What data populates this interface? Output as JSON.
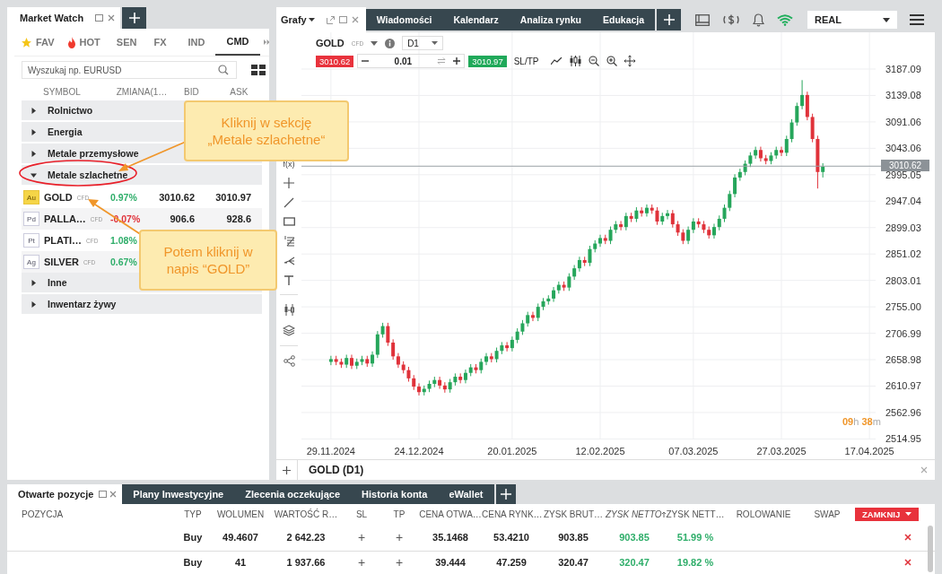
{
  "market_watch": {
    "title": "Market Watch",
    "categories": [
      {
        "label": "FAV",
        "selected": false
      },
      {
        "label": "HOT",
        "selected": false
      },
      {
        "label": "SEN",
        "selected": false
      },
      {
        "label": "FX",
        "selected": false
      },
      {
        "label": "IND",
        "selected": false
      },
      {
        "label": "CMD",
        "selected": true
      }
    ],
    "search": {
      "placeholder": "Wyszukaj np. EURUSD"
    },
    "columns": [
      "SYMBOL",
      "ZMIANA(1…",
      "BID",
      "ASK"
    ],
    "groups": [
      {
        "name": "Rolnictwo",
        "expanded": false
      },
      {
        "name": "Energia",
        "expanded": false
      },
      {
        "name": "Metale przemysłowe",
        "expanded": false
      },
      {
        "name": "Metale szlachetne",
        "expanded": true,
        "children": [
          {
            "badge": "Au",
            "symbol": "GOLD",
            "type": "CFD",
            "change": "0.97%",
            "color": "#2fae6a",
            "bid": "3010.62",
            "ask": "3010.97"
          },
          {
            "badge": "Pd",
            "symbol": "PALLA…",
            "type": "CFD",
            "change": "-0.07%",
            "color": "#e0323a",
            "bid": "906.6",
            "ask": "928.6"
          },
          {
            "badge": "Pt",
            "symbol": "PLATI…",
            "type": "CFD",
            "change": "1.08%",
            "color": "#2fae6a"
          },
          {
            "badge": "Ag",
            "symbol": "SILVER",
            "type": "CFD",
            "change": "0.67%",
            "color": "#2fae6a"
          }
        ]
      },
      {
        "name": "Inne",
        "expanded": false
      },
      {
        "name": "Inwentarz żywy",
        "expanded": false
      }
    ]
  },
  "chart_tabs": {
    "main": "Grafy",
    "tabs": [
      "Wiadomości",
      "Kalendarz",
      "Analiza rynku",
      "Edukacja"
    ]
  },
  "account": {
    "value": "REAL"
  },
  "chart": {
    "symbol": "GOLD",
    "type": "CFD",
    "timeframe": "D1",
    "sell": "3010.62",
    "volume": "0.01",
    "buy": "3010.97",
    "sltp": "SL/TP",
    "fx_label": "f(x)",
    "countdown": [
      {
        "value": "09",
        "unit": "h"
      },
      {
        "value": "38",
        "unit": "m"
      }
    ],
    "chart_data": {
      "type": "candlestick",
      "title": "GOLD (D1)",
      "grid": true,
      "ylim": [
        2514.95,
        3253.9
      ],
      "ref_lines": [
        {
          "axis": "y",
          "value": 3010.62,
          "label": "3010.62"
        }
      ],
      "yticks": [
        {
          "value": 3187.09,
          "label": "3187.09"
        },
        {
          "value": 3139.08,
          "label": "3139.08"
        },
        {
          "value": 3091.06,
          "label": "3091.06"
        },
        {
          "value": 3043.06,
          "label": "3043.06"
        },
        {
          "value": 2995.05,
          "label": "2995.05"
        },
        {
          "value": 2947.04,
          "label": "2947.04"
        },
        {
          "value": 2899.03,
          "label": "2899.03"
        },
        {
          "value": 2851.02,
          "label": "2851.02"
        },
        {
          "value": 2803.01,
          "label": "2803.01"
        },
        {
          "value": 2755.0,
          "label": "2755.00"
        },
        {
          "value": 2706.99,
          "label": "2706.99"
        },
        {
          "value": 2658.98,
          "label": "2658.98"
        },
        {
          "value": 2610.97,
          "label": "2610.97"
        },
        {
          "value": 2562.96,
          "label": "2562.96"
        },
        {
          "value": 2514.95,
          "label": "2514.95"
        }
      ],
      "categories": [
        "29.11.2024",
        null,
        null,
        null,
        null,
        null,
        null,
        null,
        null,
        null,
        null,
        null,
        null,
        null,
        null,
        null,
        null,
        "24.12.2024",
        null,
        null,
        null,
        null,
        null,
        null,
        null,
        null,
        null,
        null,
        null,
        null,
        null,
        null,
        null,
        null,
        null,
        "20.01.2025",
        null,
        null,
        null,
        null,
        null,
        null,
        null,
        null,
        null,
        null,
        null,
        null,
        null,
        null,
        null,
        null,
        "12.02.2025",
        null,
        null,
        null,
        null,
        null,
        null,
        null,
        null,
        null,
        null,
        null,
        null,
        null,
        null,
        null,
        null,
        null,
        "07.03.2025",
        null,
        null,
        null,
        null,
        null,
        null,
        null,
        null,
        null,
        null,
        null,
        null,
        null,
        null,
        null,
        null,
        "27.03.2025",
        null,
        null,
        null,
        null,
        null,
        null,
        null,
        null,
        null,
        null,
        null,
        null,
        null,
        null,
        null,
        null,
        "17.04.2025"
      ],
      "ohlc": [
        [
          2655,
          2666,
          2649,
          2660
        ],
        [
          2660,
          2666,
          2649,
          2655
        ],
        [
          2655,
          2661,
          2644,
          2650
        ],
        [
          2650,
          2668,
          2644,
          2662
        ],
        [
          2662,
          2668,
          2642,
          2648
        ],
        [
          2648,
          2661,
          2642,
          2655
        ],
        [
          2655,
          2666,
          2649,
          2660
        ],
        [
          2660,
          2666,
          2646,
          2652
        ],
        [
          2652,
          2674,
          2646,
          2668
        ],
        [
          2668,
          2711,
          2662,
          2705
        ],
        [
          2705,
          2726,
          2699,
          2720
        ],
        [
          2720,
          2726,
          2684,
          2690
        ],
        [
          2690,
          2696,
          2659,
          2665
        ],
        [
          2665,
          2671,
          2644,
          2650
        ],
        [
          2650,
          2656,
          2634,
          2640
        ],
        [
          2640,
          2646,
          2619,
          2625
        ],
        [
          2625,
          2631,
          2604,
          2610
        ],
        [
          2610,
          2616,
          2594,
          2600
        ],
        [
          2600,
          2612,
          2594,
          2606
        ],
        [
          2606,
          2621,
          2600,
          2615
        ],
        [
          2615,
          2628,
          2609,
          2622
        ],
        [
          2622,
          2628,
          2606,
          2612
        ],
        [
          2612,
          2618,
          2599,
          2605
        ],
        [
          2605,
          2624,
          2599,
          2618
        ],
        [
          2618,
          2634,
          2612,
          2628
        ],
        [
          2628,
          2634,
          2616,
          2622
        ],
        [
          2622,
          2641,
          2616,
          2635
        ],
        [
          2635,
          2651,
          2629,
          2645
        ],
        [
          2645,
          2651,
          2634,
          2640
        ],
        [
          2640,
          2661,
          2634,
          2655
        ],
        [
          2655,
          2671,
          2649,
          2665
        ],
        [
          2665,
          2671,
          2654,
          2660
        ],
        [
          2660,
          2681,
          2654,
          2675
        ],
        [
          2675,
          2691,
          2669,
          2685
        ],
        [
          2685,
          2691,
          2674,
          2680
        ],
        [
          2680,
          2701,
          2674,
          2695
        ],
        [
          2695,
          2716,
          2689,
          2710
        ],
        [
          2710,
          2731,
          2704,
          2725
        ],
        [
          2725,
          2746,
          2719,
          2740
        ],
        [
          2740,
          2746,
          2729,
          2735
        ],
        [
          2735,
          2761,
          2729,
          2755
        ],
        [
          2755,
          2771,
          2749,
          2765
        ],
        [
          2765,
          2776,
          2759,
          2770
        ],
        [
          2770,
          2791,
          2764,
          2785
        ],
        [
          2785,
          2801,
          2779,
          2795
        ],
        [
          2795,
          2801,
          2784,
          2790
        ],
        [
          2790,
          2816,
          2784,
          2810
        ],
        [
          2810,
          2831,
          2804,
          2825
        ],
        [
          2825,
          2846,
          2819,
          2840
        ],
        [
          2840,
          2846,
          2829,
          2835
        ],
        [
          2835,
          2866,
          2829,
          2860
        ],
        [
          2860,
          2876,
          2854,
          2870
        ],
        [
          2870,
          2886,
          2864,
          2880
        ],
        [
          2880,
          2886,
          2869,
          2875
        ],
        [
          2875,
          2901,
          2869,
          2895
        ],
        [
          2895,
          2911,
          2889,
          2905
        ],
        [
          2905,
          2911,
          2894,
          2900
        ],
        [
          2900,
          2926,
          2894,
          2920
        ],
        [
          2920,
          2926,
          2909,
          2915
        ],
        [
          2915,
          2936,
          2909,
          2930
        ],
        [
          2930,
          2936,
          2919,
          2925
        ],
        [
          2925,
          2941,
          2919,
          2935
        ],
        [
          2935,
          2941,
          2924,
          2930
        ],
        [
          2930,
          2936,
          2904,
          2910
        ],
        [
          2910,
          2926,
          2904,
          2920
        ],
        [
          2920,
          2931,
          2914,
          2925
        ],
        [
          2925,
          2931,
          2899,
          2905
        ],
        [
          2905,
          2911,
          2884,
          2890
        ],
        [
          2890,
          2896,
          2869,
          2875
        ],
        [
          2875,
          2901,
          2869,
          2895
        ],
        [
          2895,
          2916,
          2889,
          2910
        ],
        [
          2910,
          2916,
          2899,
          2905
        ],
        [
          2905,
          2911,
          2889,
          2895
        ],
        [
          2895,
          2901,
          2879,
          2885
        ],
        [
          2885,
          2906,
          2879,
          2900
        ],
        [
          2900,
          2921,
          2894,
          2915
        ],
        [
          2915,
          2941,
          2909,
          2935
        ],
        [
          2935,
          2966,
          2929,
          2960
        ],
        [
          2960,
          2996,
          2954,
          2990
        ],
        [
          2990,
          3006,
          2984,
          3000
        ],
        [
          3000,
          3021,
          2994,
          3015
        ],
        [
          3015,
          3036,
          3009,
          3030
        ],
        [
          3030,
          3046,
          3024,
          3040
        ],
        [
          3040,
          3046,
          3019,
          3025
        ],
        [
          3025,
          3031,
          3014,
          3020
        ],
        [
          3020,
          3036,
          3014,
          3030
        ],
        [
          3030,
          3046,
          3024,
          3040
        ],
        [
          3040,
          3046,
          3029,
          3035
        ],
        [
          3035,
          3066,
          3029,
          3060
        ],
        [
          3060,
          3096,
          3054,
          3090
        ],
        [
          3090,
          3126,
          3084,
          3120
        ],
        [
          3120,
          3167,
          3114,
          3140
        ],
        [
          3140,
          3146,
          3094,
          3100
        ],
        [
          3100,
          3106,
          3054,
          3060
        ],
        [
          3060,
          3066,
          2970,
          3000
        ],
        [
          3000,
          3016,
          2990,
          3010
        ],
        null,
        null,
        null,
        null,
        null,
        null,
        null,
        null,
        null
      ]
    }
  },
  "positions": {
    "tabs": [
      {
        "label": "Otwarte pozycje",
        "selected": true
      },
      {
        "label": "Plany Inwestycyjne",
        "selected": false
      },
      {
        "label": "Zlecenia oczekujące",
        "selected": false
      },
      {
        "label": "Historia konta",
        "selected": false
      },
      {
        "label": "eWallet",
        "selected": false
      }
    ],
    "columns": [
      {
        "label": "POZYCJA",
        "sorted": false
      },
      {
        "label": "TYP",
        "sorted": false
      },
      {
        "label": "WOLUMEN",
        "sorted": false
      },
      {
        "label": "WARTOŚĆ R…",
        "sorted": false
      },
      {
        "label": "SL",
        "sorted": false
      },
      {
        "label": "TP",
        "sorted": false
      },
      {
        "label": "CENA OTWA…",
        "sorted": false
      },
      {
        "label": "CENA RYNK…",
        "sorted": false
      },
      {
        "label": "ZYSK BRUT…",
        "sorted": false
      },
      {
        "label": "ZYSK NETTO",
        "sorted": true
      },
      {
        "label": "ZYSK NETT…",
        "sorted": false
      },
      {
        "label": "ROLOWANIE",
        "sorted": false
      },
      {
        "label": "SWAP",
        "sorted": false
      }
    ],
    "close_all": "ZAMKNIJ",
    "rows": [
      {
        "type": "Buy",
        "volume": "49.4607",
        "value": "2 642.23",
        "sl": "+",
        "tp": "+",
        "open": "35.1468",
        "market": "53.4210",
        "gross": "903.85",
        "net": "903.85",
        "net_pct": "51.99 %"
      },
      {
        "type": "Buy",
        "volume": "41",
        "value": "1 937.66",
        "sl": "+",
        "tp": "+",
        "open": "39.444",
        "market": "47.259",
        "gross": "320.47",
        "net": "320.47",
        "net_pct": "19.82 %"
      }
    ]
  },
  "callouts": [
    {
      "text": "Kliknij w sekcję\n„Metale szlachetne“"
    },
    {
      "text": "Potem kliknij w\nnapis “GOLD”"
    }
  ]
}
